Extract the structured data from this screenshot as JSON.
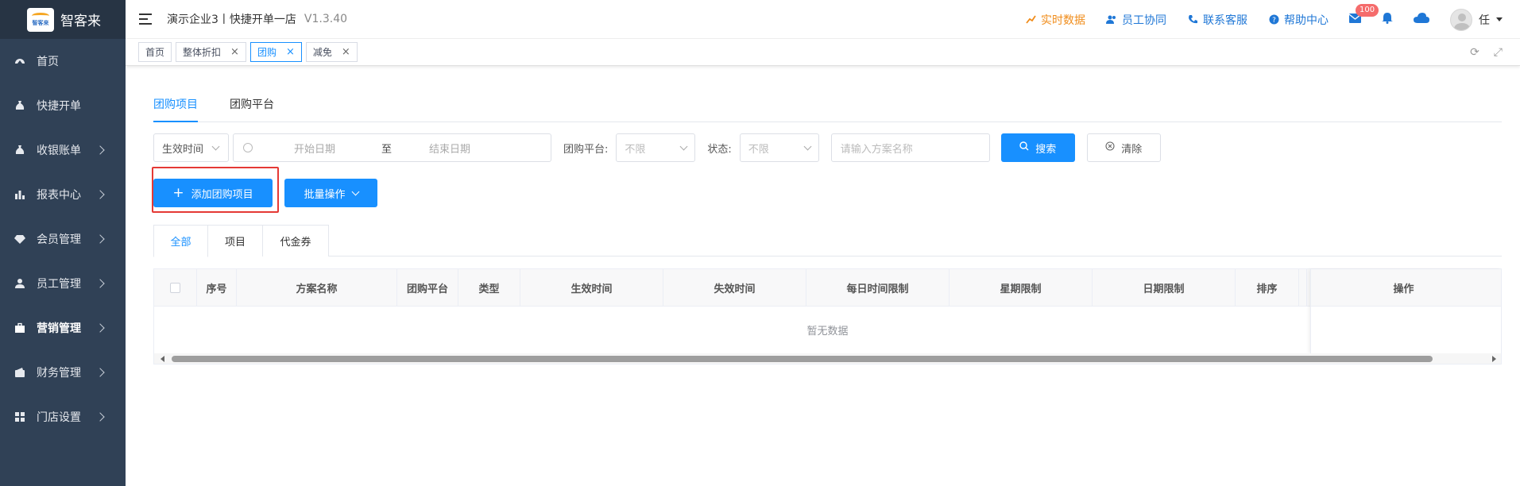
{
  "brand": {
    "name": "智客来",
    "logo_text": "智客来"
  },
  "sidebar": {
    "items": [
      {
        "label": "首页",
        "icon": "dashboard-icon",
        "has_children": false
      },
      {
        "label": "快捷开单",
        "icon": "moneybag-icon",
        "has_children": false
      },
      {
        "label": "收银账单",
        "icon": "moneybag-icon",
        "has_children": true
      },
      {
        "label": "报表中心",
        "icon": "bar-chart-icon",
        "has_children": true
      },
      {
        "label": "会员管理",
        "icon": "diamond-icon",
        "has_children": true
      },
      {
        "label": "员工管理",
        "icon": "user-icon",
        "has_children": true
      },
      {
        "label": "营销管理",
        "icon": "briefcase-icon",
        "has_children": true,
        "active": true
      },
      {
        "label": "财务管理",
        "icon": "wallet-icon",
        "has_children": true
      },
      {
        "label": "门店设置",
        "icon": "grid-icon",
        "has_children": true
      }
    ]
  },
  "header": {
    "title": "演示企业3丨快捷开单一店",
    "version": "V1.3.40",
    "links": {
      "realtime": "实时数据",
      "staff": "员工协同",
      "contact": "联系客服",
      "help": "帮助中心"
    },
    "mail_badge": "100",
    "user_name": "任"
  },
  "tags": [
    {
      "label": "首页",
      "closable": false
    },
    {
      "label": "整体折扣",
      "closable": true
    },
    {
      "label": "团购",
      "closable": true,
      "active": true
    },
    {
      "label": "减免",
      "closable": true
    }
  ],
  "page_tabs": {
    "tab1": "团购项目",
    "tab2": "团购平台"
  },
  "filters": {
    "time_type": "生效时间",
    "start_placeholder": "开始日期",
    "range_sep": "至",
    "end_placeholder": "结束日期",
    "platform_label": "团购平台:",
    "platform_value": "不限",
    "status_label": "状态:",
    "status_value": "不限",
    "name_placeholder": "请输入方案名称",
    "search_label": "搜索",
    "clear_label": "清除"
  },
  "actions": {
    "add_label": "添加团购项目",
    "batch_label": "批量操作"
  },
  "sub_tabs": {
    "all": "全部",
    "item": "项目",
    "voucher": "代金券"
  },
  "table": {
    "columns": [
      "序号",
      "方案名称",
      "团购平台",
      "类型",
      "生效时间",
      "失效时间",
      "每日时间限制",
      "星期限制",
      "日期限制",
      "排序",
      "操作"
    ],
    "empty_text": "暂无数据"
  },
  "colors": {
    "primary": "#1890ff",
    "sidebar": "#304156",
    "highlight": "#e53935",
    "accent_orange": "#f08c1a"
  }
}
